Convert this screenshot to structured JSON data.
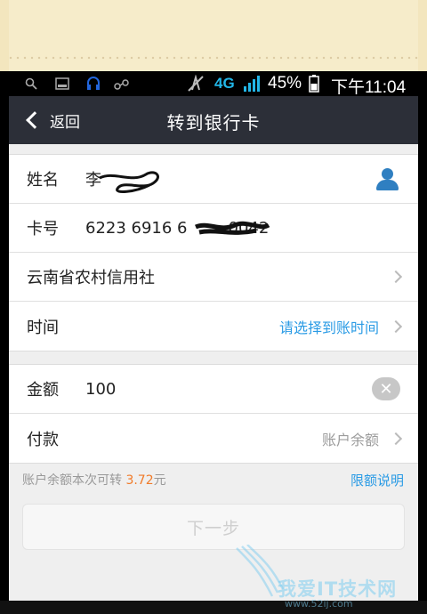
{
  "status_bar": {
    "network": "4G",
    "battery": "45%",
    "time": "下午11:04",
    "icons": [
      "search-icon",
      "image-icon",
      "headset-icon",
      "usb-icon",
      "signal-icon"
    ]
  },
  "header": {
    "back_label": "返回",
    "title": "转到银行卡"
  },
  "form": {
    "name_label": "姓名",
    "name_value": "李",
    "card_label": "卡号",
    "card_value": "6223 6916 6",
    "card_value_tail": "0042",
    "bank": "云南省农村信用社",
    "time_label": "时间",
    "time_placeholder": "请选择到账时间"
  },
  "payment": {
    "amount_label": "金额",
    "amount_value": "100",
    "pay_label": "付款",
    "pay_method": "账户余额"
  },
  "hint": {
    "prefix": "账户余额本次可转",
    "amount": "3.72",
    "suffix": "元",
    "limit_link": "限额说明"
  },
  "next_button": "下一步",
  "watermark": {
    "text": "我爱IT技术网",
    "url": "www.52ij.com"
  },
  "colors": {
    "titlebar": "#2c2f38",
    "link": "#2a9be5",
    "amount_highlight": "#f07b2a"
  }
}
